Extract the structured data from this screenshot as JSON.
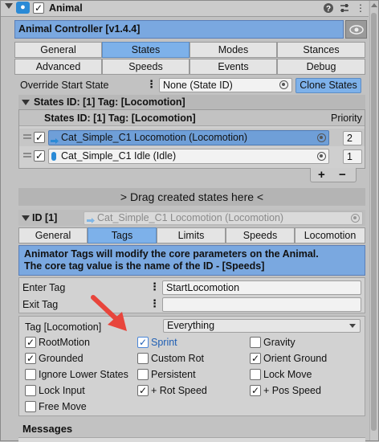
{
  "header": {
    "title": "Animal",
    "checked": true
  },
  "controller": {
    "title": "Animal Controller [v1.4.4]"
  },
  "main_tabs": {
    "row1": [
      "General",
      "States",
      "Modes",
      "Stances"
    ],
    "row2": [
      "Advanced",
      "Speeds",
      "Events",
      "Debug"
    ],
    "active": "States"
  },
  "override": {
    "label": "Override Start State",
    "value": "None (State ID)",
    "clone_label": "Clone States"
  },
  "states": {
    "foldout_label": "States  ID: [1]  Tag: [Locomotion]",
    "list_header": "States  ID: [1]  Tag: [Locomotion]",
    "priority_label": "Priority",
    "items": [
      {
        "name": "Cat_Simple_C1 Locomotion (Locomotion)",
        "priority": "2",
        "selected": true
      },
      {
        "name": "Cat_Simple_C1 Idle (Idle)",
        "priority": "1",
        "selected": false
      }
    ],
    "add_label": "+",
    "remove_label": "−"
  },
  "drag_area": {
    "text": "> Drag created states here <"
  },
  "id_row": {
    "label": "ID [1]",
    "value": "Cat_Simple_C1 Locomotion (Locomotion)"
  },
  "sub_tabs": {
    "items": [
      "General",
      "Tags",
      "Limits",
      "Speeds",
      "Locomotion"
    ],
    "active": "Tags"
  },
  "info": {
    "line1": "Animator Tags will modify the core parameters on the Animal.",
    "line2": "The core tag value is the name of the ID - [Speeds]"
  },
  "tags": {
    "enter_label": "Enter Tag",
    "enter_value": "StartLocomotion",
    "exit_label": "Exit Tag",
    "exit_value": ""
  },
  "tag_options": {
    "label": "Tag [Locomotion]",
    "dropdown_value": "Everything",
    "items": [
      {
        "label": "RootMotion",
        "checked": true
      },
      {
        "label": "Sprint",
        "checked": true,
        "highlight": true
      },
      {
        "label": "Gravity",
        "checked": false
      },
      {
        "label": "Grounded",
        "checked": true
      },
      {
        "label": "Custom Rot",
        "checked": false
      },
      {
        "label": "Orient Ground",
        "checked": true
      },
      {
        "label": "Ignore Lower States",
        "checked": false
      },
      {
        "label": "Persistent",
        "checked": false
      },
      {
        "label": "Lock Move",
        "checked": false
      },
      {
        "label": "Lock Input",
        "checked": false
      },
      {
        "label": "+ Rot Speed",
        "checked": true
      },
      {
        "label": "+ Pos Speed",
        "checked": true
      },
      {
        "label": "Free Move",
        "checked": false
      }
    ]
  },
  "messages": {
    "label": "Messages"
  },
  "colors": {
    "accent": "#7db1ea",
    "info_bg": "#7aa8e0",
    "annotation_arrow": "#e8453c"
  }
}
